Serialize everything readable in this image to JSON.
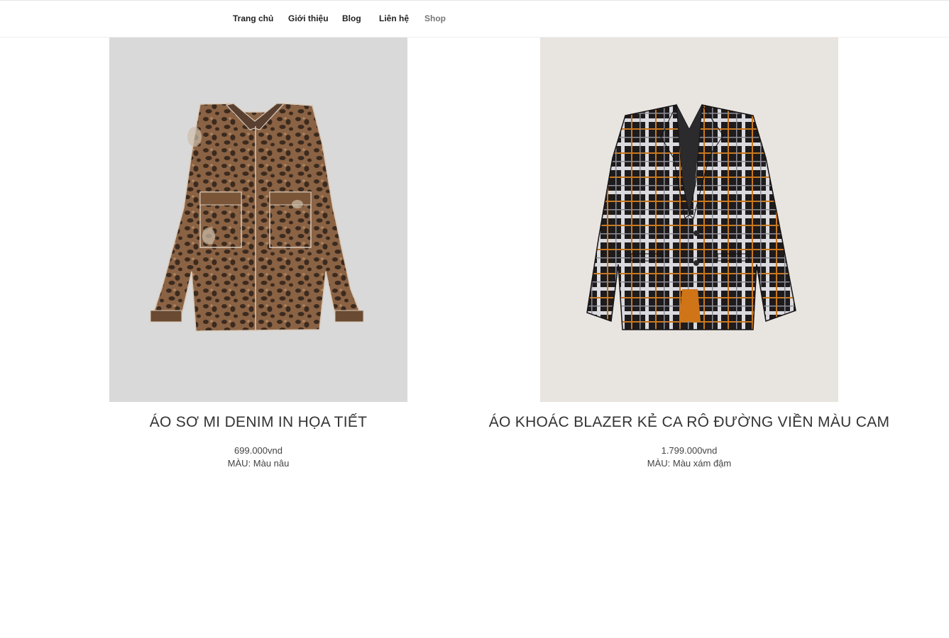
{
  "nav": {
    "items": [
      {
        "label": "Trang chủ"
      },
      {
        "label": "Giới thiệu"
      },
      {
        "label": "Blog"
      },
      {
        "label": "Liên hệ"
      },
      {
        "label": "Shop",
        "current": true
      }
    ]
  },
  "products": [
    {
      "name": "ÁO SƠ MI DENIM IN HỌA TIẾT",
      "price": "699.000vnd",
      "color_label": "MÀU:",
      "color_value": "Màu nâu",
      "image_bg": "#d9d9d9",
      "image_icon": "leopard-denim-shirt-image"
    },
    {
      "name": "ÁO KHOÁC BLAZER KẺ CA RÔ ĐƯỜNG VIỀN MÀU CAM",
      "price": "1.799.000vnd",
      "color_label": "MÀU:",
      "color_value": "Màu xám đậm",
      "image_bg": "#e8e4df",
      "image_icon": "plaid-blazer-image"
    }
  ]
}
